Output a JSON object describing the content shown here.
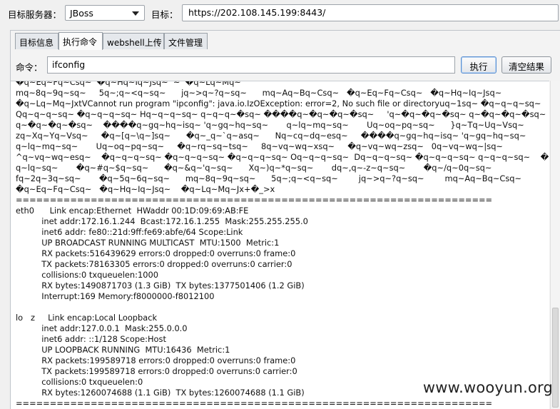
{
  "header": {
    "server_label": "目标服务器：",
    "server_value": "JBoss",
    "target_label": "目标：",
    "target_value": "https://202.108.145.199:8443/"
  },
  "tabs": [
    {
      "label": "目标信息",
      "active": false
    },
    {
      "label": "执行命令",
      "active": true
    },
    {
      "label": "webshell上传",
      "active": false
    },
    {
      "label": "文件管理",
      "active": false
    }
  ],
  "command": {
    "label": "命令：",
    "value": "ifconfig",
    "execute_label": "执行",
    "clear_label": "清空结果"
  },
  "output_text": "�q~Eq~Fq~Csq~  �q~Hq~Iq~Jsq~  ~  �q~Lq~Mq~\nmq~8q~9q~sq~     5q~;q~<q~sq~      jq~>q~?q~sq~      mq~Aq~Bq~Csq~   �q~Eq~Fq~Csq~   �q~Hq~Iq~Jsq~\n�q~Lq~Mq~JxtVCannot run program \"ipconfig\": java.io.IzOException: error=2, No such file or directoryuq~1sq~ �q~q~q~sq~\nQq~q~q~sq~ �q~q~q~sq~ Hq~q~q~sq~ q~q~q~�sq~ ����q~�q~�q~�sq~     'q~�q~�q~�sq~ q~�q~�q~�sq~\nq~�q~�q~�sq~    ����q~gq~hq~isq~ 'q~gq~hq~sq~       q~lq~mq~sq~       Uq~oq~pq~sq~      }q~Tq~Uq~Vsq~\nzq~Xq~Yq~Vsq~     �q~[q~\\q~]sq~      �q~_q~`q~asq~      Nq~cq~dq~esq~     ����q~gq~hq~isq~ 'q~gq~hq~sq~\nq~lq~mq~sq~       Uq~oq~pq~sq~     �q~rq~sq~tsq~     8q~vq~wq~xsq~     �q~vq~wq~zsq~   0q~vq~wq~|sq~\n^q~vq~wq~esq~    �q~q~q~sq~ �q~q~q~sq~ �q~q~q~sq~ Oq~q~q~sq~  Dq~q~q~sq~ �q~q~q~sq~ q~q~q~sq~    �q~\nq~lq~sq~       �q~#q~$q~sq~      �q~&q~'q~sq~      Xq~)q~*q~sq~       dq~,q~-z~q~sq~       �q~/q~0q~sq~\nfq~2q~3q~sq~       �q~5q~6q~sq~      mq~8q~9q~sq~      5q~;q~<q~sq~        jq~>q~?q~sq~        mq~Aq~Bq~Csq~\n�q~Eq~Fq~Csq~   �q~Hq~Iq~Jsq~    �q~Lq~Mq~Jx+�_>x\n======================================================================\neth0      Link encap:Ethernet  HWaddr 00:1D:09:69:AB:FE\n          inet addr:172.16.1.244  Bcast:172.16.1.255  Mask:255.255.255.0\n          inet6 addr: fe80::21d:9ff:fe69:abfe/64 Scope:Link\n          UP BROADCAST RUNNING MULTICAST  MTU:1500  Metric:1\n          RX packets:516439629 errors:0 dropped:0 overruns:0 frame:0\n          TX packets:78163305 errors:0 dropped:0 overruns:0 carrier:0\n          collisions:0 txqueuelen:1000\n          RX bytes:1490871703 (1.3 GiB)  TX bytes:1377501406 (1.2 GiB)\n          Interrupt:169 Memory:f8000000-f8012100\n\nlo   z     Link encap:Local Loopback\n          inet addr:127.0.0.1  Mask:255.0.0.0\n          inet6 addr: ::1/128 Scope:Host\n          UP LOOPBACK RUNNING  MTU:16436  Metric:1\n          RX packets:199589718 errors:0 dropped:0 overruns:0 frame:0\n          TX packets:199589718 errors:0 dropped:0 overruns:0 carrier:0\n          collisions:0 txqueuelen:0\n          RX bytes:1260074688 (1.1 GiB)  TX bytes:1260074688 (1.1 GiB)\n======================================================================",
  "watermark": "www.wooyun.org"
}
